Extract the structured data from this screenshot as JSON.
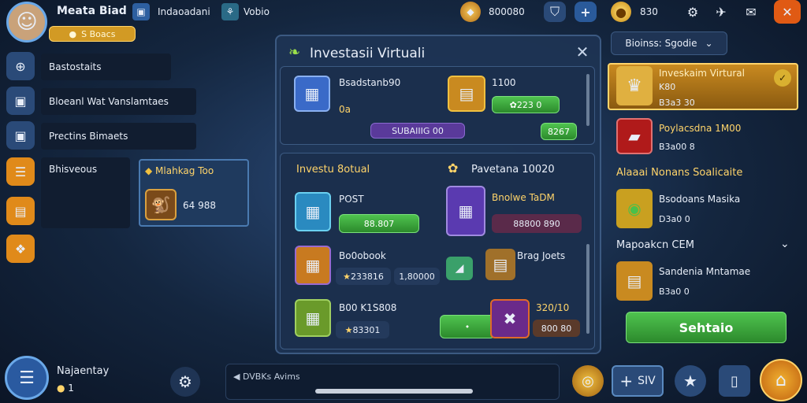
{
  "topbar": {
    "player_name": "Meata Biad",
    "gold_label": "S Boacs",
    "tab1": "Indaoadani",
    "tab2": "Vobio",
    "currency1": "800080",
    "currency2": "830"
  },
  "left_menu": {
    "items": [
      "Bastostaits",
      "Bloeanl Wat Vanslamtaes",
      "Prectins Bimaets",
      "Bhisveous"
    ],
    "card_title": "Mlahkag Too",
    "card_value": "64 988"
  },
  "modal": {
    "title": "Investasii Virtuali",
    "top_item_name": "Bsadstanb90",
    "top_item_sub": "0a",
    "top_price_label": "1100",
    "top_price": "223 0",
    "top_tag": "SUBAIIIG 00",
    "top_bar_value": "8267",
    "section_left_title": "Investu 8otual",
    "section_right_title": "Pavetana 10020",
    "items": [
      {
        "name": "POST",
        "value": "88.807"
      },
      {
        "name": "Bnolwe TaDM",
        "value": "88800 890"
      },
      {
        "name": "Bo0obook",
        "value": "233816",
        "extra": "1,80000"
      },
      {
        "name": "Brag Joets",
        "value": ""
      },
      {
        "name": "B00 K1S808",
        "value": "83301"
      },
      {
        "name": "320/10",
        "value": "800 80"
      }
    ]
  },
  "right_panel": {
    "dropdown": "Bioinss: Sgodie",
    "featured_title": "Inveskaim Virtural",
    "featured_sub": "K80",
    "featured_val": "B3a3 30",
    "item2_title": "Poylacsdna 1M00",
    "item2_val": "B3a00 8",
    "section_title": "Alaaai Nonans Soalicaite",
    "item3_title": "Bsodoans Masika",
    "item3_val": "D3a0 0",
    "section2_title": "Mapoakcn CEM",
    "item4_title": "Sandenia Mntamae",
    "item4_val": "B3a0 0",
    "action_label": "Sehtaio"
  },
  "bottombar": {
    "player": "Najaentay",
    "player_count": "1",
    "chat_text": "DVBKs Avims",
    "plus_label": "SIV"
  }
}
